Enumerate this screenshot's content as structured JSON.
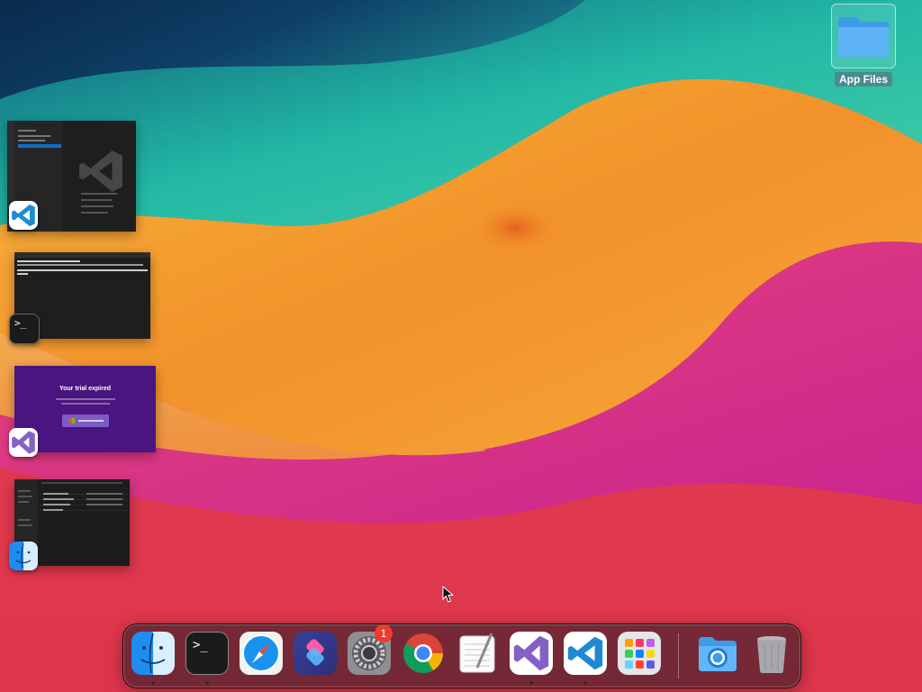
{
  "desktop": {
    "folders": [
      {
        "label": "App Files",
        "icon": "folder-icon"
      }
    ]
  },
  "stage_manager": {
    "windows": [
      {
        "app": "Visual Studio Code",
        "icon": "vscode-icon"
      },
      {
        "app": "Terminal",
        "icon": "terminal-icon"
      },
      {
        "app": "Visual Studio",
        "icon": "visual-studio-icon",
        "preview_heading": "Your trial expired"
      },
      {
        "app": "Finder",
        "icon": "finder-icon"
      }
    ]
  },
  "dock": {
    "apps": [
      {
        "name": "Finder",
        "icon": "finder-icon",
        "running": true
      },
      {
        "name": "Terminal",
        "icon": "terminal-icon",
        "running": true
      },
      {
        "name": "Safari",
        "icon": "safari-icon",
        "running": false
      },
      {
        "name": "Shortcuts",
        "icon": "shortcuts-icon",
        "running": false
      },
      {
        "name": "System Settings",
        "icon": "settings-icon",
        "running": false,
        "badge": "1"
      },
      {
        "name": "Google Chrome",
        "icon": "chrome-icon",
        "running": false
      },
      {
        "name": "TextEdit",
        "icon": "textedit-icon",
        "running": false
      },
      {
        "name": "Visual Studio",
        "icon": "visual-studio-icon",
        "running": true
      },
      {
        "name": "Visual Studio Code",
        "icon": "vscode-icon",
        "running": true
      },
      {
        "name": "Launchpad",
        "icon": "launchpad-icon",
        "running": false
      }
    ],
    "others": [
      {
        "name": "Downloads",
        "icon": "downloads-folder-icon"
      },
      {
        "name": "Trash",
        "icon": "trash-icon"
      }
    ]
  },
  "colors": {
    "wallpaper_teal": "#1fb8a0",
    "wallpaper_orange": "#f29a2a",
    "wallpaper_magenta": "#d62d8a",
    "wallpaper_red": "#e0394e",
    "vs_purple": "#4a1580",
    "vscode_blue": "#1f8ad2",
    "badge_red": "#f03a2e"
  }
}
